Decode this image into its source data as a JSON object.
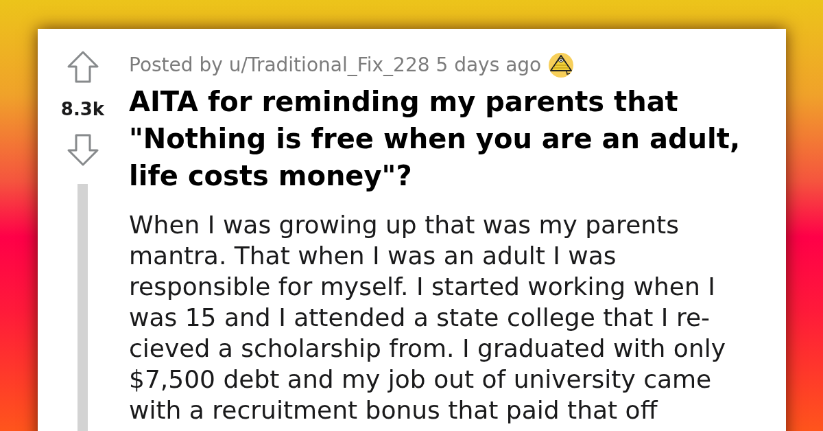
{
  "post": {
    "votes": {
      "count": "8.3k"
    },
    "meta": "Posted by u/Traditional_Fix_228 5 days ago",
    "title": "AITA for reminding my parents that \"Nothing is free when you are an adult, life costs money\"?",
    "body": "When I was growing up that was my parents mantra. That when I was an adult I was responsible for myself. I started working when I was 15 and I attended a state college that I re-cieved a scholarship from. I graduated with only $7,500 debt and my job out of university came with a recruitment bonus that paid that off"
  }
}
